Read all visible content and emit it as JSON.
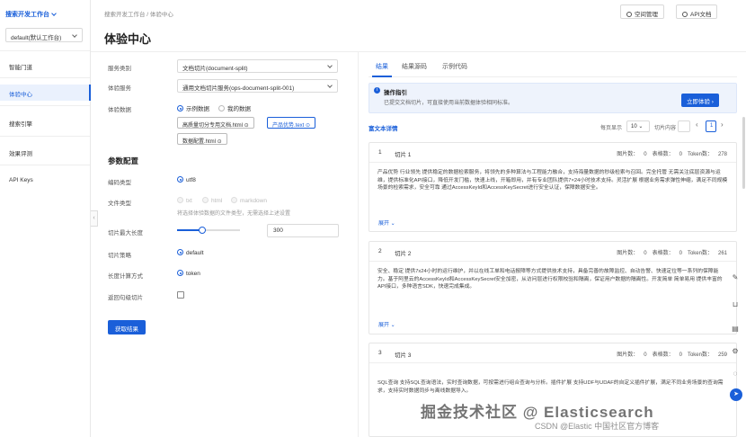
{
  "sidebar": {
    "workspace": "搜索开发工作台",
    "region": "default(默认工作台)",
    "items": [
      {
        "label": "智能门道"
      },
      {
        "label": "体验中心"
      },
      {
        "label": "搜索引擎"
      },
      {
        "label": "效果评测"
      },
      {
        "label": "API Keys"
      }
    ],
    "collapse": "‹"
  },
  "header": {
    "breadcrumb": "搜索开发工作台 / 体验中心",
    "title": "体验中心",
    "space_btn": "空间管理",
    "api_btn": "API文档"
  },
  "form": {
    "service_type_label": "服务类别",
    "service_type_value": "文档切片(document-split)",
    "service_label": "体验服务",
    "service_value": "通用文档切片服务(ops-document-split-001)",
    "data_label": "体验数据",
    "data_sample": "示例数据",
    "data_mine": "我的数据",
    "chips": [
      "高质量切分专用文档.html",
      "产品优势.text",
      "数据配置.html"
    ],
    "params_title": "参数配置",
    "encoding_label": "编码类型",
    "encoding_value": "utf8",
    "file_type_label": "文件类型",
    "file_types": [
      "txt",
      "html",
      "markdown"
    ],
    "file_type_hint": "将选择体验数据的文件类型，无需选择上述设置",
    "maxlen_label": "切片最大长度",
    "maxlen_value": "300",
    "strategy_label": "切片策略",
    "strategy_value": "default",
    "length_calc_label": "长度计算方式",
    "length_calc_value": "token",
    "return_label": "返回句级切片",
    "submit": "获取结果"
  },
  "result": {
    "tabs": [
      "结果",
      "结果源码",
      "示例代码"
    ],
    "guide_title": "操作指引",
    "guide_desc": "已提交文档切片，可直接使用当前数据体验相同标准。",
    "guide_btn": "立即体验",
    "list_title": "富文本详情",
    "page_size_label": "每页显示",
    "page_size": "10",
    "page_jump_label": "切片内容",
    "page_current": "1",
    "page_prev": "‹",
    "page_next": "›",
    "stats_labels": {
      "images": "图片数：",
      "tables": "表格数：",
      "tokens": "Token数："
    },
    "expand": "展开",
    "cards": [
      {
        "num": "1",
        "name": "切片 1",
        "images": "0",
        "tables": "0",
        "tokens": "278",
        "text": "产品优势 行业领先 提供稳定的数据检索服务，将领先的多种算法与工程能力融合，支持海量数据的秒级检索与召回。完全托管 无需关注底层资源与运维，提供标准化API接口，降低开发门槛，快速上线，开箱即用，并有专业团队提供7×24小时技术支持。灵活扩展 根据业务需求弹性伸缩，满足不同规模场景的检索需求，安全可靠 通过AccessKeyId和AccessKeySecret进行安全认证，保障数据安全。"
      },
      {
        "num": "2",
        "name": "切片 2",
        "images": "0",
        "tables": "0",
        "tokens": "261",
        "text": "安全、稳定 提供7x24小时的运行维护，并以在线工单和电话报障等方式提供技术支持，具备完善的故障监控、自动告警、快速定位等一系列的保障能力。基于阿里云的AccessKeyId和AccessKeySecret安全加密，从访问层进行权限校验和隔离，保证用户数据的隔离性。开发简单 简单易用 提供丰富的API接口，多种语言SDK，快速完成集成。"
      },
      {
        "num": "3",
        "name": "切片 3",
        "images": "0",
        "tables": "0",
        "tokens": "259",
        "text": "SQL查询 支持SQL查询语法，实时查询数据，可按需进行组合查询与分析。插件扩展 支持UDF与UDAF的自定义插件扩展，满足不同业务场景的查询需求，支持实时数据同步与离线数据导入。"
      }
    ]
  },
  "watermark": "掘金技术社区 @ Elasticsearch",
  "watermark2": "CSDN @Elastic 中国社区官方博客"
}
